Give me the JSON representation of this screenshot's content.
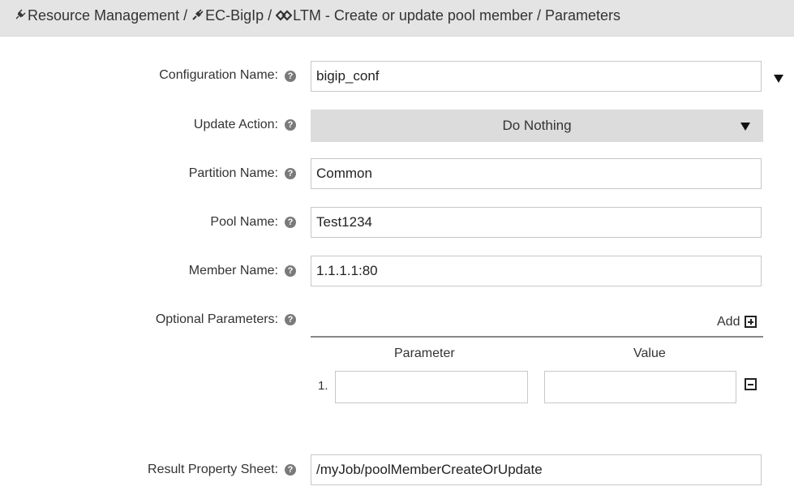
{
  "breadcrumb": {
    "items": [
      {
        "label": "Resource Management",
        "icon": "plug-outline-icon"
      },
      {
        "label": "EC-BigIp",
        "icon": "plug-icon"
      },
      {
        "label": "LTM - Create or update pool member",
        "icon": "diamonds-icon"
      },
      {
        "label": "Parameters"
      }
    ],
    "separator": "/"
  },
  "form": {
    "configuration_name": {
      "label": "Configuration Name:",
      "value": "bigip_conf"
    },
    "update_action": {
      "label": "Update Action:",
      "value": "Do Nothing"
    },
    "partition_name": {
      "label": "Partition Name:",
      "value": "Common"
    },
    "pool_name": {
      "label": "Pool Name:",
      "value": "Test1234"
    },
    "member_name": {
      "label": "Member Name:",
      "value": "1.1.1.1:80"
    },
    "optional_parameters": {
      "label": "Optional Parameters:",
      "add_label": "Add",
      "columns": [
        "Parameter",
        "Value"
      ],
      "rows": [
        {
          "index": "1.",
          "parameter": "",
          "value": ""
        }
      ]
    },
    "result_property_sheet": {
      "label": "Result Property Sheet:",
      "value": "/myJob/poolMemberCreateOrUpdate"
    }
  },
  "help_glyph": "?",
  "colors": {
    "header_bg": "#e4e4e4",
    "dropdown_bg": "#dcdcdc",
    "help_bg": "#7a7a7a"
  }
}
